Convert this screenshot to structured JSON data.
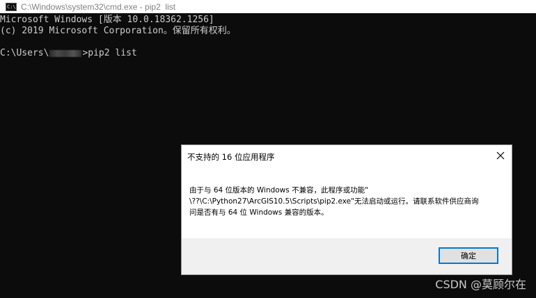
{
  "window": {
    "title": "C:\\Windows\\system32\\cmd.exe - pip2  list",
    "icon": "C:\\",
    "icon_name": "console-icon"
  },
  "console": {
    "line1": "Microsoft Windows [版本 10.0.18362.1256]",
    "line2": "(c) 2019 Microsoft Corporation。保留所有权利。",
    "prompt_prefix": "C:\\Users\\",
    "prompt_suffix": ">pip2 list"
  },
  "dialog": {
    "title": "不支持的 16 位应用程序",
    "message_line1": "由于与 64 位版本的 Windows 不兼容，此程序或功能\"",
    "message_line2": "\\??\\C:\\Python27\\ArcGIS10.5\\Scripts\\pip2.exe\"无法启动或运行。请联系软件供应商询",
    "message_line3": "问是否有与 64 位 Windows 兼容的版本。",
    "ok_label": "确定",
    "close_icon": "close-icon",
    "accent_color": "#0078d7"
  },
  "watermark": "CSDN @莫顾尔在"
}
